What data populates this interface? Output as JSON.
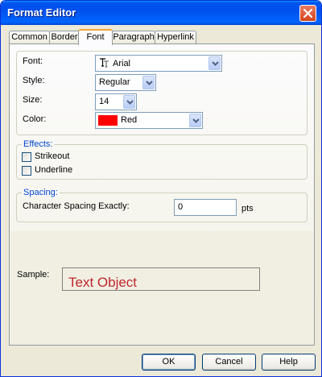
{
  "window": {
    "title": "Format Editor"
  },
  "tabs": [
    {
      "label": "Common"
    },
    {
      "label": "Border"
    },
    {
      "label": "Font"
    },
    {
      "label": "Paragraph"
    },
    {
      "label": "Hyperlink"
    }
  ],
  "active_tab": "Font",
  "font_group": {
    "font_label": "Font:",
    "font_value": "Arial",
    "style_label": "Style:",
    "style_value": "Regular",
    "size_label": "Size:",
    "size_value": "14",
    "color_label": "Color:",
    "color_value": "Red",
    "color_swatch": "#ff0000"
  },
  "effects": {
    "legend": "Effects:",
    "strikeout_label": "Strikeout",
    "strikeout_checked": false,
    "underline_label": "Underline",
    "underline_checked": false
  },
  "spacing": {
    "legend": "Spacing:",
    "label": "Character Spacing Exactly:",
    "value": "0",
    "unit": "pts"
  },
  "sample": {
    "label": "Sample:",
    "text": "Text Object",
    "text_color": "#c0262d"
  },
  "buttons": {
    "ok": "OK",
    "cancel": "Cancel",
    "help": "Help"
  },
  "icons": {
    "font": "truetype-font-icon",
    "close": "close-icon",
    "dropdown": "chevron-down-icon"
  }
}
